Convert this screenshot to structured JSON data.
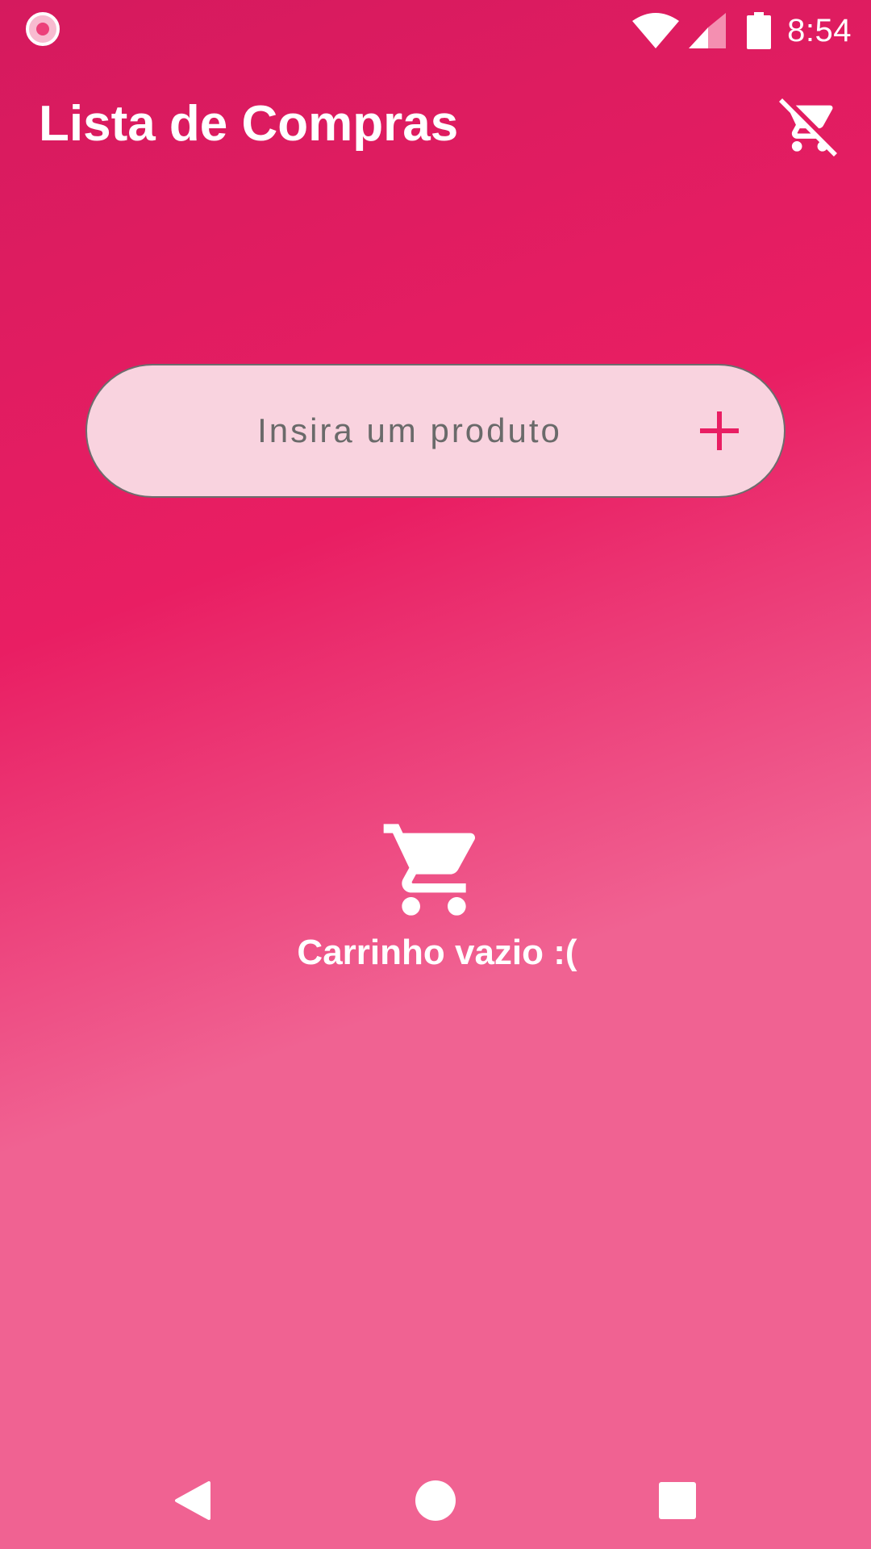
{
  "status_bar": {
    "time": "8:54",
    "icons": [
      "recording-indicator-icon",
      "wifi-icon",
      "cell-signal-icon",
      "battery-icon"
    ]
  },
  "app_bar": {
    "title": "Lista de Compras",
    "action_icon": "remove-shopping-cart-icon"
  },
  "product_input": {
    "placeholder": "Insira um produto",
    "value": "",
    "add_icon": "plus-icon"
  },
  "empty_state": {
    "icon": "shopping-cart-icon",
    "text": "Carrinho vazio :("
  },
  "nav_bar": {
    "icons": [
      "back-icon",
      "home-icon",
      "recents-icon"
    ]
  },
  "colors": {
    "background_top": "#d51a5e",
    "background_mid": "#e91e63",
    "background_bottom": "#f06292",
    "input_fill": "#f9d3df",
    "accent": "#e91e63",
    "text_light": "#ffffff"
  }
}
